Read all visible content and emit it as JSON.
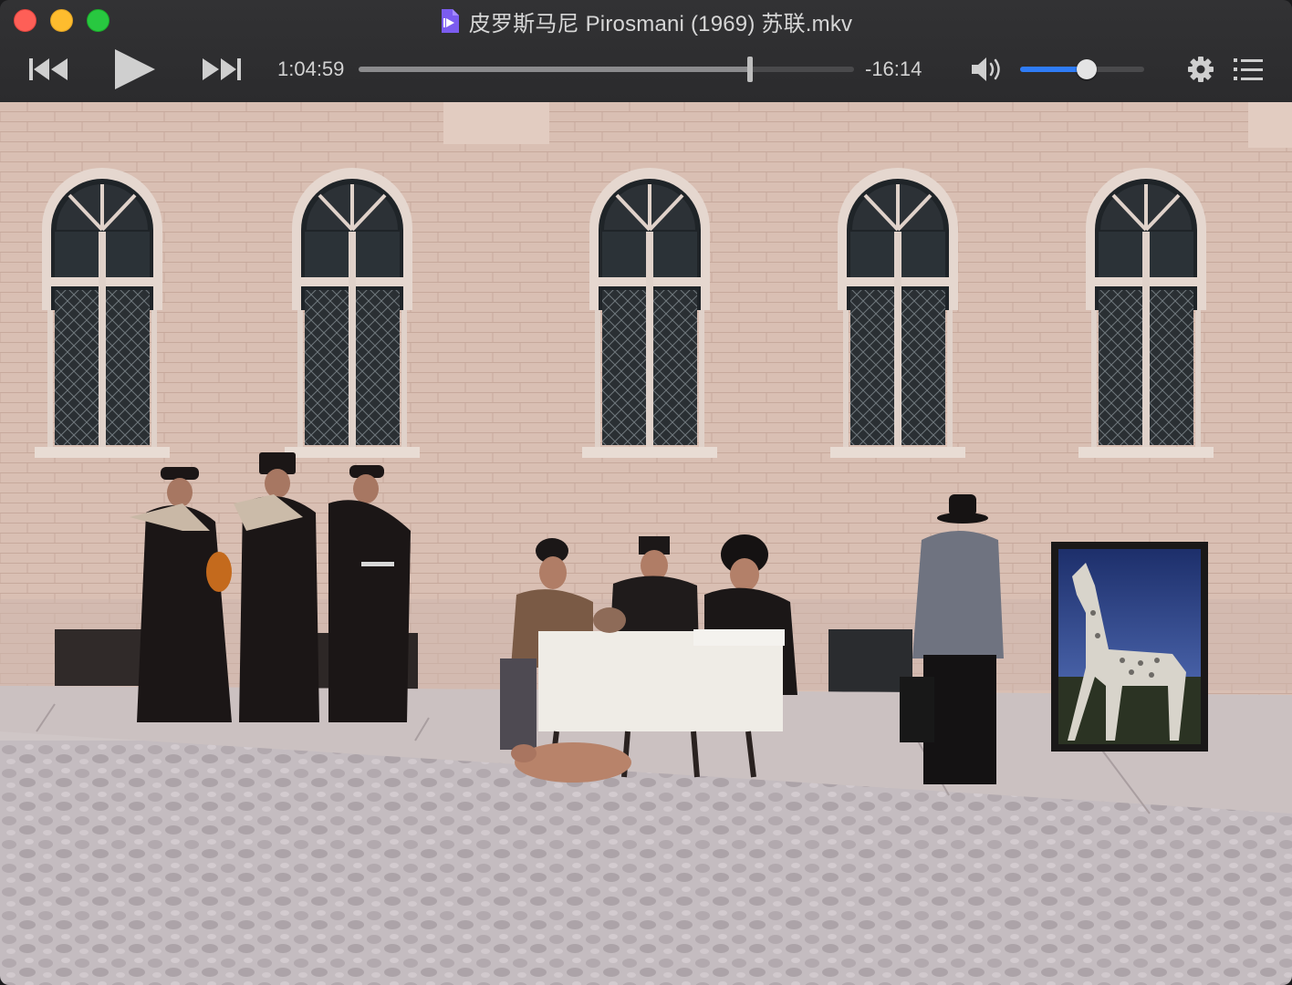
{
  "window": {
    "title": "皮罗斯马尼 Pirosmani (1969) 苏联.mkv",
    "file_icon": "video-file-icon"
  },
  "controls": {
    "prev_icon": "skip-back-icon",
    "play_icon": "play-icon",
    "next_icon": "skip-forward-icon",
    "current_time": "1:04:59",
    "remaining_time": "-16:14",
    "progress_fraction": 0.79,
    "volume_icon": "speaker-icon",
    "volume_fraction": 0.54,
    "settings_icon": "gear-icon",
    "playlist_icon": "list-icon",
    "accent_color": "#2f7cf6"
  },
  "video": {
    "scene": "film-frame"
  }
}
